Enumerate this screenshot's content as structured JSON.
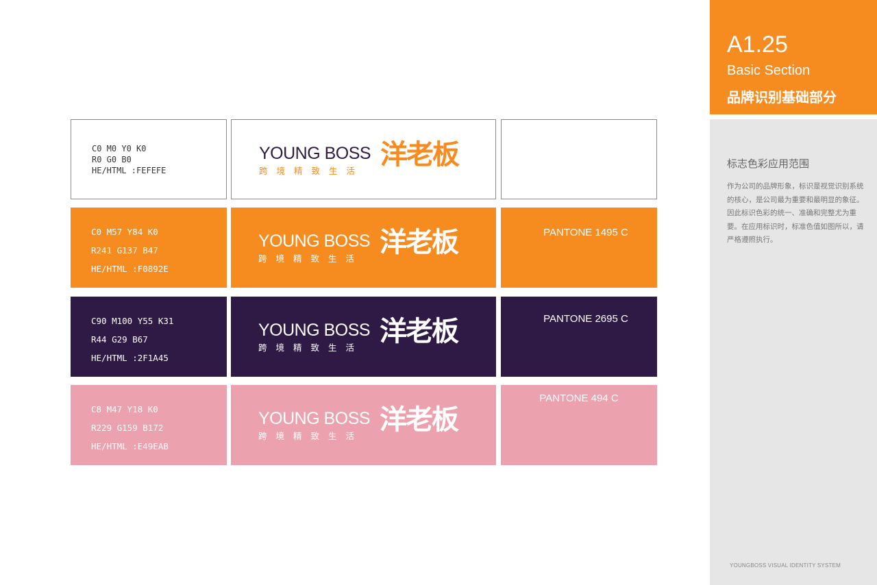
{
  "section": {
    "code": "A1.25",
    "title_en": "Basic Section",
    "title_cn": "品牌识别基础部分"
  },
  "description": {
    "title": "标志色彩应用范围",
    "body": "作为公司的品牌形象，标识是视觉识别系统的核心，是公司最为重要和最明显的象征。因此标识色彩的统一、准确和完整尤为重要。在应用标识时，标准色值如图所以，请严格遵照执行。"
  },
  "footer": "YOUNGBOSS VISUAL IDENTITY SYSTEM",
  "logo": {
    "en": "YOUNG BOSS",
    "sub": "跨境精致生活",
    "cn": "洋老板"
  },
  "colors": [
    {
      "cmyk": "C0  M0  Y0  K0",
      "rgb": "R0  G0 B0",
      "hex": "HE/HTML :FEFEFE",
      "pantone": "",
      "bg": "#FFFFFF",
      "text": "#333333",
      "logo_en_color": "#2F1A45",
      "logo_cn_color": "#F68B1F"
    },
    {
      "cmyk": "C0  M57  Y84  K0",
      "rgb": "R241  G137 B47",
      "hex": "HE/HTML :F0892E",
      "pantone": "PANTONE 1495 C",
      "bg": "#F68B1F",
      "text": "#FFFFFF",
      "logo_en_color": "#FFFFFF",
      "logo_cn_color": "#FFFFFF"
    },
    {
      "cmyk": "C90  M100  Y55  K31",
      "rgb": "R44  G29  B67",
      "hex": "HE/HTML :2F1A45",
      "pantone": "PANTONE 2695 C",
      "bg": "#2F1A45",
      "text": "#FFFFFF",
      "logo_en_color": "#FFFFFF",
      "logo_cn_color": "#FFFFFF"
    },
    {
      "cmyk": "C8  M47  Y18  K0",
      "rgb": "R229  G159  B172",
      "hex": "HE/HTML :E49EAB",
      "pantone": "PANTONE 494 C",
      "bg": "#EBA1AE",
      "text": "#FFFFFF",
      "logo_en_color": "#FFFFFF",
      "logo_cn_color": "#FFFFFF"
    }
  ]
}
